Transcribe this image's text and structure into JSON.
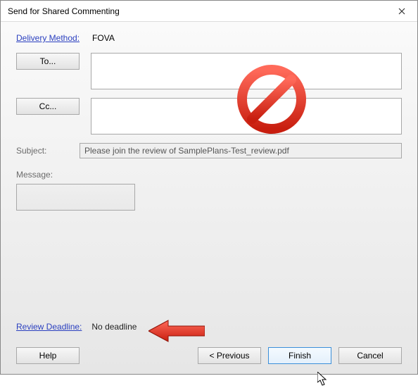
{
  "window": {
    "title": "Send for Shared Commenting"
  },
  "delivery": {
    "label": "Delivery Method:",
    "value": "FOVA"
  },
  "to": {
    "button": "To...",
    "value": ""
  },
  "cc": {
    "button": "Cc...",
    "value": ""
  },
  "subject": {
    "label": "Subject:",
    "value": "Please join the review of SamplePlans-Test_review.pdf"
  },
  "message": {
    "label": "Message:",
    "value": ""
  },
  "deadline": {
    "label": "Review Deadline:",
    "value": "No deadline"
  },
  "buttons": {
    "help": "Help",
    "previous": "< Previous",
    "finish": "Finish",
    "cancel": "Cancel"
  }
}
